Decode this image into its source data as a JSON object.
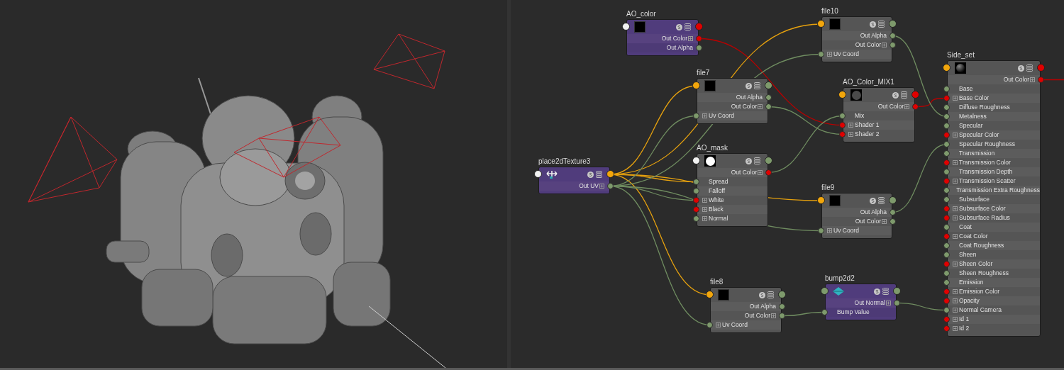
{
  "node_editor": {
    "nodes": [
      {
        "title": "AO_color",
        "kind": "utility",
        "outputs": [
          {
            "label": "Out Color",
            "kind": "color"
          },
          {
            "label": "Out Alpha",
            "kind": "scalar"
          }
        ]
      },
      {
        "title": "file10",
        "kind": "texture",
        "outputs": [
          {
            "label": "Out Alpha",
            "kind": "scalar"
          },
          {
            "label": "Out Color",
            "kind": "vector"
          }
        ],
        "inputs": [
          {
            "label": "Uv Coord",
            "kind": "vector"
          }
        ]
      },
      {
        "title": "file7",
        "kind": "texture",
        "outputs": [
          {
            "label": "Out Alpha",
            "kind": "scalar"
          },
          {
            "label": "Out Color",
            "kind": "vector"
          }
        ],
        "inputs": [
          {
            "label": "Uv Coord",
            "kind": "vector"
          }
        ]
      },
      {
        "title": "AO_Color_MIX1",
        "kind": "texture",
        "outputs": [
          {
            "label": "Out Color",
            "kind": "color"
          }
        ],
        "inputs": [
          {
            "label": "Mix",
            "kind": "scalar"
          },
          {
            "label": "Shader 1",
            "kind": "color"
          },
          {
            "label": "Shader 2",
            "kind": "color"
          }
        ]
      },
      {
        "title": "Side_set",
        "kind": "texture",
        "outputs": [
          {
            "label": "Out Color",
            "kind": "color"
          }
        ],
        "inputs": [
          {
            "label": "Base",
            "kind": "scalar"
          },
          {
            "label": "Base Color",
            "kind": "color"
          },
          {
            "label": "Diffuse Roughness",
            "kind": "scalar"
          },
          {
            "label": "Metalness",
            "kind": "scalar"
          },
          {
            "label": "Specular",
            "kind": "scalar"
          },
          {
            "label": "Specular Color",
            "kind": "color"
          },
          {
            "label": "Specular Roughness",
            "kind": "scalar"
          },
          {
            "label": "Transmission",
            "kind": "scalar"
          },
          {
            "label": "Transmission Color",
            "kind": "color"
          },
          {
            "label": "Transmission Depth",
            "kind": "scalar"
          },
          {
            "label": "Transmission Scatter",
            "kind": "color"
          },
          {
            "label": "Transmission Extra Roughness",
            "kind": "scalar"
          },
          {
            "label": "Subsurface",
            "kind": "scalar"
          },
          {
            "label": "Subsurface Color",
            "kind": "color"
          },
          {
            "label": "Subsurface Radius",
            "kind": "color"
          },
          {
            "label": "Coat",
            "kind": "scalar"
          },
          {
            "label": "Coat Color",
            "kind": "color"
          },
          {
            "label": "Coat Roughness",
            "kind": "scalar"
          },
          {
            "label": "Sheen",
            "kind": "scalar"
          },
          {
            "label": "Sheen Color",
            "kind": "color"
          },
          {
            "label": "Sheen Roughness",
            "kind": "scalar"
          },
          {
            "label": "Emission",
            "kind": "scalar"
          },
          {
            "label": "Emission Color",
            "kind": "color"
          },
          {
            "label": "Opacity",
            "kind": "color"
          },
          {
            "label": "Normal Camera",
            "kind": "vector"
          },
          {
            "label": "Id 1",
            "kind": "color"
          },
          {
            "label": "Id 2",
            "kind": "color"
          }
        ]
      },
      {
        "title": "place2dTexture3",
        "kind": "utility",
        "outputs": [
          {
            "label": "Out UV",
            "kind": "vector"
          }
        ]
      },
      {
        "title": "AO_mask",
        "kind": "texture",
        "outputs": [
          {
            "label": "Out Color",
            "kind": "color"
          }
        ],
        "inputs": [
          {
            "label": "Spread",
            "kind": "scalar"
          },
          {
            "label": "Falloff",
            "kind": "scalar"
          },
          {
            "label": "White",
            "kind": "color"
          },
          {
            "label": "Black",
            "kind": "color"
          },
          {
            "label": "Normal",
            "kind": "vector"
          }
        ]
      },
      {
        "title": "file9",
        "kind": "texture",
        "outputs": [
          {
            "label": "Out Alpha",
            "kind": "scalar"
          },
          {
            "label": "Out Color",
            "kind": "vector"
          }
        ],
        "inputs": [
          {
            "label": "Uv Coord",
            "kind": "vector"
          }
        ]
      },
      {
        "title": "file8",
        "kind": "texture",
        "outputs": [
          {
            "label": "Out Alpha",
            "kind": "scalar"
          },
          {
            "label": "Out Color",
            "kind": "vector"
          }
        ],
        "inputs": [
          {
            "label": "Uv Coord",
            "kind": "vector"
          }
        ]
      },
      {
        "title": "bump2d2",
        "kind": "utility",
        "outputs": [
          {
            "label": "Out Normal",
            "kind": "vector"
          }
        ],
        "inputs": [
          {
            "label": "Bump Value",
            "kind": "scalar"
          }
        ]
      }
    ]
  }
}
